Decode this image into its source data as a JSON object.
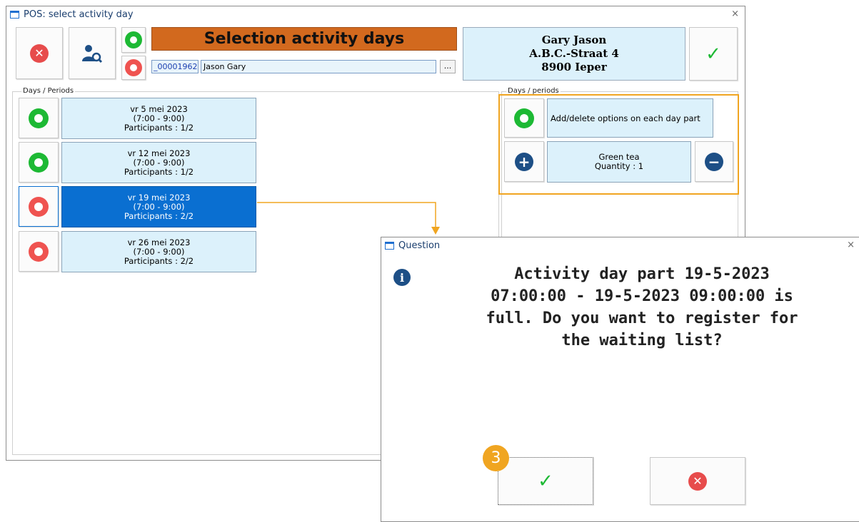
{
  "main_window": {
    "title": "POS: select activity day",
    "close_glyph": "×",
    "header_title": "Selection activity days",
    "customer_code": "_00001962",
    "customer_name": "Jason Gary",
    "browse_label": "...",
    "address": [
      "Gary Jason",
      "A.B.C.-Straat 4",
      "8900 Ieper"
    ]
  },
  "left_group": {
    "label": "Days / Periods",
    "days": [
      {
        "date": "vr 5 mei 2023",
        "time": "(7:00 - 9:00)",
        "participants": "Participants : 1/2",
        "status": "available"
      },
      {
        "date": "vr 12 mei 2023",
        "time": "(7:00 - 9:00)",
        "participants": "Participants : 1/2",
        "status": "available"
      },
      {
        "date": "vr 19 mei 2023",
        "time": "(7:00 - 9:00)",
        "participants": "Participants : 2/2",
        "status": "full",
        "selected": true
      },
      {
        "date": "vr 26 mei 2023",
        "time": "(7:00 - 9:00)",
        "participants": "Participants : 2/2",
        "status": "full"
      }
    ]
  },
  "right_group": {
    "label": "Days / periods",
    "options_label": "Add/delete options on each day part",
    "item_name": "Green tea",
    "item_quantity": "Quantity : 1"
  },
  "question_dialog": {
    "title": "Question",
    "close_glyph": "×",
    "message_lines": [
      "Activity day part 19-5-2023",
      "07:00:00 - 19-5-2023 09:00:00 is",
      "full. Do you want to register for",
      "the waiting list?"
    ],
    "step_number": "3"
  },
  "colors": {
    "accent_orange": "#f0a521",
    "header_orange": "#d2691e",
    "selected_blue": "#0a6fd1",
    "green": "#1db934",
    "red": "#e74c4c",
    "card_bg": "#dcf1fb"
  },
  "icons": [
    "close-icon",
    "user-search-icon",
    "green-ring-icon",
    "red-ring-icon",
    "checkmark-icon",
    "plus-icon",
    "minus-icon",
    "info-icon",
    "window-icon"
  ]
}
